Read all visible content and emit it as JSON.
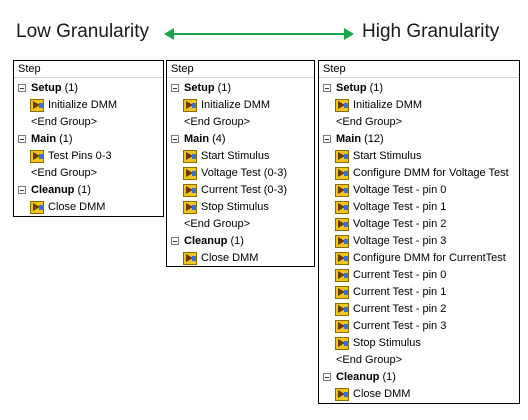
{
  "titles": {
    "low": "Low Granularity",
    "high": "High Granularity"
  },
  "arrow_color": "#1aa64a",
  "panels": [
    {
      "header": "Step",
      "rows": [
        {
          "type": "group",
          "label": "Setup",
          "count": "(1)"
        },
        {
          "type": "step",
          "label": "Initialize DMM"
        },
        {
          "type": "end",
          "label": "<End Group>"
        },
        {
          "type": "group",
          "label": "Main",
          "count": "(1)"
        },
        {
          "type": "step",
          "label": "Test Pins 0-3"
        },
        {
          "type": "end",
          "label": "<End Group>"
        },
        {
          "type": "group",
          "label": "Cleanup",
          "count": "(1)"
        },
        {
          "type": "step",
          "label": "Close DMM"
        }
      ]
    },
    {
      "header": "Step",
      "rows": [
        {
          "type": "group",
          "label": "Setup",
          "count": "(1)"
        },
        {
          "type": "step",
          "label": "Initialize DMM"
        },
        {
          "type": "end",
          "label": "<End Group>"
        },
        {
          "type": "group",
          "label": "Main",
          "count": "(4)"
        },
        {
          "type": "step",
          "label": "Start Stimulus"
        },
        {
          "type": "step",
          "label": "Voltage Test (0-3)"
        },
        {
          "type": "step",
          "label": "Current Test (0-3)"
        },
        {
          "type": "step",
          "label": "Stop Stimulus"
        },
        {
          "type": "end",
          "label": "<End Group>"
        },
        {
          "type": "group",
          "label": "Cleanup",
          "count": "(1)"
        },
        {
          "type": "step",
          "label": "Close DMM"
        }
      ]
    },
    {
      "header": "Step",
      "rows": [
        {
          "type": "group",
          "label": "Setup",
          "count": "(1)"
        },
        {
          "type": "step",
          "label": "Initialize DMM"
        },
        {
          "type": "end",
          "label": "<End Group>"
        },
        {
          "type": "group",
          "label": "Main",
          "count": "(12)"
        },
        {
          "type": "step",
          "label": "Start Stimulus"
        },
        {
          "type": "step",
          "label": "Configure DMM for Voltage Test"
        },
        {
          "type": "step",
          "label": "Voltage Test - pin 0"
        },
        {
          "type": "step",
          "label": "Voltage Test - pin 1"
        },
        {
          "type": "step",
          "label": "Voltage Test - pin 2"
        },
        {
          "type": "step",
          "label": "Voltage Test - pin 3"
        },
        {
          "type": "step",
          "label": "Configure DMM for CurrentTest"
        },
        {
          "type": "step",
          "label": "Current Test - pin 0"
        },
        {
          "type": "step",
          "label": "Current Test - pin 1"
        },
        {
          "type": "step",
          "label": "Current Test - pin 2"
        },
        {
          "type": "step",
          "label": "Current Test - pin 3"
        },
        {
          "type": "step",
          "label": "Stop Stimulus"
        },
        {
          "type": "end",
          "label": "<End Group>"
        },
        {
          "type": "group",
          "label": "Cleanup",
          "count": "(1)"
        },
        {
          "type": "step",
          "label": "Close DMM"
        }
      ]
    }
  ]
}
